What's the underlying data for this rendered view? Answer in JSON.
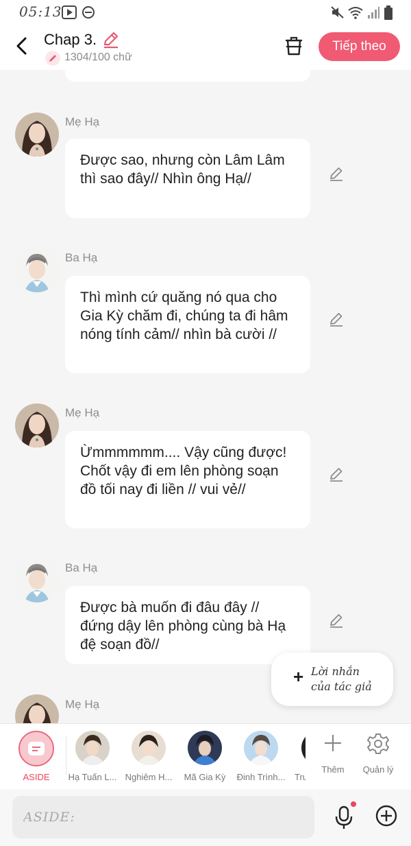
{
  "status_bar": {
    "time": "05:13"
  },
  "header": {
    "title": "Chap 3.",
    "word_count": "1304/100 chữ",
    "next_label": "Tiếp theo"
  },
  "messages": [
    {
      "speaker": "Mẹ Hạ",
      "text": "Được sao, nhưng còn Lâm Lâm thì sao đây// Nhìn ông Hạ//"
    },
    {
      "speaker": "Ba Hạ",
      "text": "Thì mình cứ quăng nó qua cho Gia Kỳ chăm đi, chúng ta đi hâm nóng tính cảm// nhìn bà cười //"
    },
    {
      "speaker": "Mẹ Hạ",
      "text": "Ừmmmmmm.... Vậy cũng được! Chốt vậy đi em lên phòng soạn đồ tối nay đi liền // vui vẻ//"
    },
    {
      "speaker": "Ba Hạ",
      "text": "Được bà muốn đi đâu đây // đứng dậy lên phòng cùng bà Hạ đệ soạn đồ//"
    },
    {
      "speaker": "Mẹ Hạ",
      "text": ""
    }
  ],
  "author_note": {
    "line1": "Lời nhắn",
    "line2": "của tác giả"
  },
  "characters": {
    "aside_label": "ASIDE",
    "items": [
      "Hạ Tuấn L...",
      "Nghiêm H...",
      "Mã Gia Kỳ",
      "Đinh Trình...",
      "Trư"
    ],
    "more_label": "Thêm",
    "manage_label": "Quản lý"
  },
  "input": {
    "placeholder": "ASIDE:"
  },
  "colors": {
    "accent": "#f05a73",
    "aside": "#e8475f"
  }
}
